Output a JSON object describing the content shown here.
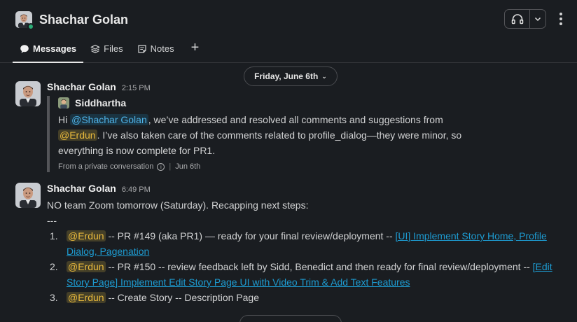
{
  "channel": {
    "title": "Shachar Golan",
    "presence_color": "#2bac76"
  },
  "header_actions": {
    "huddle_icon": "headphones-icon",
    "huddle_dropdown_icon": "chevron-down-icon",
    "more_icon": "kebab-menu-icon"
  },
  "tabs": [
    {
      "label": "Messages",
      "icon": "message-bubble-icon",
      "active": true
    },
    {
      "label": "Files",
      "icon": "layers-icon",
      "active": false
    },
    {
      "label": "Notes",
      "icon": "canvas-note-icon",
      "active": false
    },
    {
      "label": "+",
      "icon": "add-tab-icon",
      "active": false
    }
  ],
  "date_divider": {
    "label": "Friday, June 6th",
    "icon": "chevron-down-icon"
  },
  "messages": [
    {
      "sender": "Shachar Golan",
      "time": "2:15 PM",
      "quote": {
        "author": "Siddhartha",
        "text_before": "Hi ",
        "mention1": "@Shachar Golan",
        "text_mid": ", we’ve addressed and resolved all comments and suggestions from ",
        "mention2": "@Erdun",
        "text_after": ". I’ve also taken care of the comments related to profile_dialog—they were minor, so everything is now complete for PR1.",
        "footer_source": "From a private conversation",
        "footer_date": "Jun 6th"
      }
    },
    {
      "sender": "Shachar Golan",
      "time": "6:49 PM",
      "line1": "NO team Zoom tomorrow (Saturday). Recapping next steps:",
      "line2": "---",
      "steps": [
        {
          "num": "1.",
          "mention": "@Erdun",
          "text": " -- PR #149 (aka PR1) — ready for your final review/deployment -- ",
          "link": "[UI] Implement Story Home, Profile Dialog, Pagenation"
        },
        {
          "num": "2.",
          "mention": "@Erdun",
          "text": " -- PR #150 -- review feedback left by Sidd, Benedict and then ready for final review/deployment -- ",
          "link": "[Edit Story Page] Implement Edit Story Page UI with Video Trim & Add Text Features"
        },
        {
          "num": "3.",
          "mention": "@Erdun",
          "text": " -- Create Story -- Description Page",
          "link": ""
        }
      ]
    }
  ],
  "colors": {
    "background": "#1a1d21",
    "link": "#1d9bd1",
    "mention_user": "#4fb3e8",
    "mention_highlight": "#e8b93c"
  }
}
